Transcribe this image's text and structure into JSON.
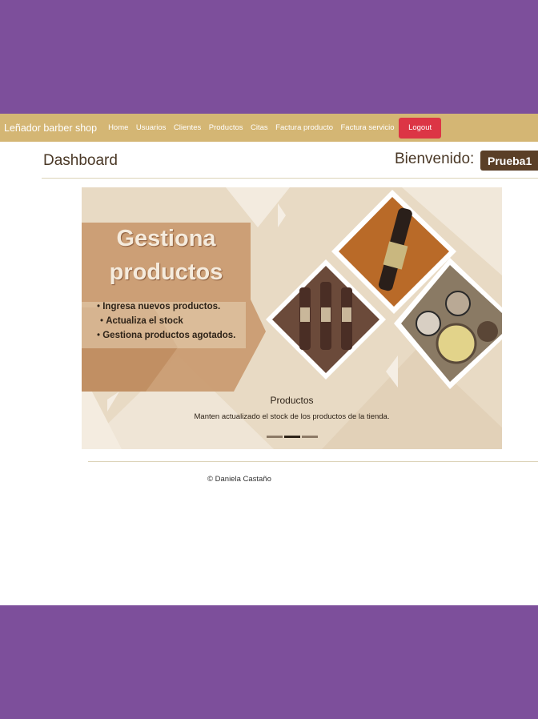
{
  "navbar": {
    "brand": "Leñador barber shop",
    "links": [
      "Home",
      "Usuarios",
      "Clientes",
      "Productos",
      "Citas",
      "Factura producto",
      "Factura servicio"
    ],
    "logout_label": "Logout"
  },
  "header": {
    "title": "Dashboard",
    "welcome_label": "Bienvenido:",
    "username": "Prueba1"
  },
  "carousel": {
    "slide_heading_line1": "Gestiona",
    "slide_heading_line2": "productos",
    "slide_bullets": [
      "Ingresa nuevos productos.",
      "Actualiza el stock",
      "Gestiona productos agotados."
    ],
    "caption_title": "Productos",
    "caption_text": "Manten actualizado el stock de los productos de la tienda.",
    "indicator_count": 3,
    "active_indicator": 2
  },
  "footer": {
    "text": "© Daniela Castaño"
  },
  "colors": {
    "background": "#7d4f9b",
    "navbar": "#d4b674",
    "logout": "#dc3545",
    "badge": "#5a3f27"
  }
}
